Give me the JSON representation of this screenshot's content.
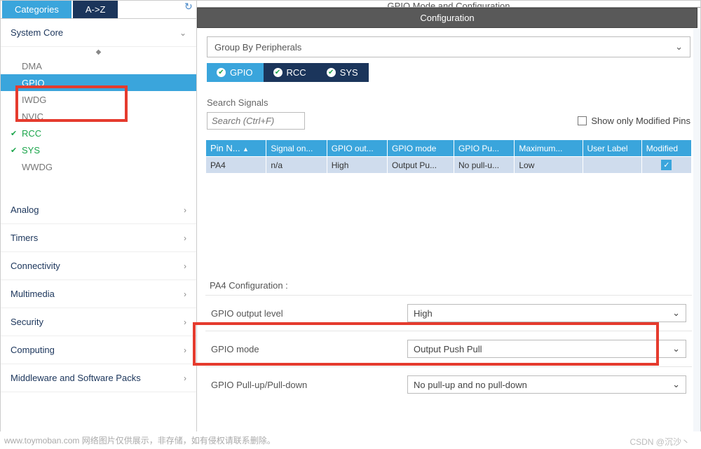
{
  "left": {
    "tabs": {
      "categories": "Categories",
      "az": "A->Z"
    },
    "sections": {
      "system_core": "System Core",
      "analog": "Analog",
      "timers": "Timers",
      "connectivity": "Connectivity",
      "multimedia": "Multimedia",
      "security": "Security",
      "computing": "Computing",
      "middleware": "Middleware and Software Packs"
    },
    "system_core_items": [
      "DMA",
      "GPIO",
      "IWDG",
      "NVIC",
      "RCC",
      "SYS",
      "WWDG"
    ]
  },
  "right": {
    "cut_title": "GPIO Mode and Configuration",
    "config_title": "Configuration",
    "group_by": "Group By Peripherals",
    "periph_tabs": {
      "gpio": "GPIO",
      "rcc": "RCC",
      "sys": "SYS"
    },
    "search_label": "Search Signals",
    "search_placeholder": "Search (Ctrl+F)",
    "show_mod": "Show only Modified Pins",
    "grid": {
      "headers": [
        "Pin N...",
        "Signal on...",
        "GPIO out...",
        "GPIO mode",
        "GPIO Pu...",
        "Maximum...",
        "User Label",
        "Modified"
      ],
      "row": {
        "pin": "PA4",
        "signal": "n/a",
        "out": "High",
        "mode": "Output Pu...",
        "pull": "No pull-u...",
        "max": "Low",
        "user": "",
        "mod": "✓"
      },
      "sort_icon": "▲"
    },
    "pa_title": "PA4 Configuration :",
    "form": {
      "out_level_lbl": "GPIO output level",
      "out_level_val": "High",
      "mode_lbl": "GPIO mode",
      "mode_val": "Output Push Pull",
      "pull_lbl": "GPIO Pull-up/Pull-down",
      "pull_val": "No pull-up and no pull-down"
    }
  },
  "footer": "www.toymoban.com 网络图片仅供展示，非存储，如有侵权请联系删除。",
  "watermark": "CSDN @沉沙丶"
}
